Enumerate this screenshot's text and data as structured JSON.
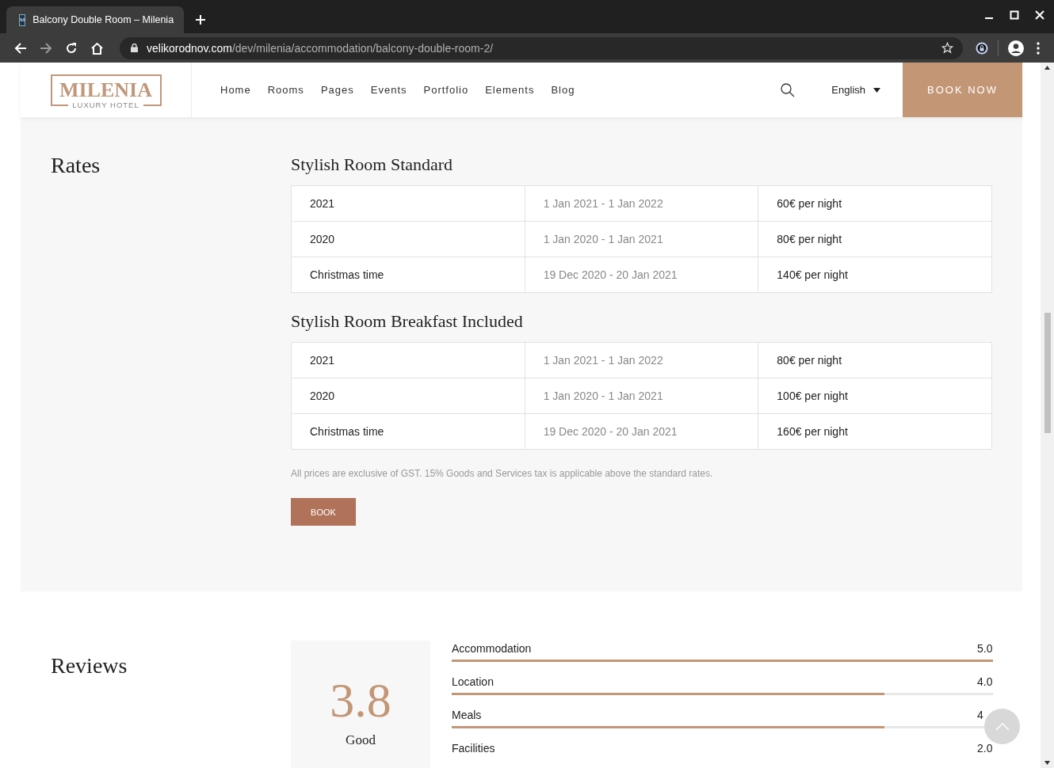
{
  "browser": {
    "tab_title": "Balcony Double Room – Milenia",
    "favicon": "M",
    "url_host": "velikorodnov.com",
    "url_path": "/dev/milenia/accommodation/balcony-double-room-2/"
  },
  "header": {
    "logo": "MILENIA",
    "logo_sub": "LUXURY HOTEL",
    "nav": [
      {
        "label": "Home"
      },
      {
        "label": "Rooms"
      },
      {
        "label": "Pages"
      },
      {
        "label": "Events"
      },
      {
        "label": "Portfolio"
      },
      {
        "label": "Elements"
      },
      {
        "label": "Blog"
      }
    ],
    "language": "English",
    "cta": "BOOK NOW"
  },
  "rates": {
    "title": "Rates",
    "tables": [
      {
        "title": "Stylish Room Standard",
        "rows": [
          {
            "name": "2021",
            "period": "1 Jan 2021 - 1 Jan 2022",
            "price": "60€ per night"
          },
          {
            "name": "2020",
            "period": "1 Jan 2020 - 1 Jan 2021",
            "price": "80€ per night"
          },
          {
            "name": "Christmas time",
            "period": "19 Dec 2020 - 20 Jan 2021",
            "price": "140€ per night"
          }
        ]
      },
      {
        "title": "Stylish Room Breakfast Included",
        "rows": [
          {
            "name": "2021",
            "period": "1 Jan 2021 - 1 Jan 2022",
            "price": "80€ per night"
          },
          {
            "name": "2020",
            "period": "1 Jan 2020 - 1 Jan 2021",
            "price": "100€ per night"
          },
          {
            "name": "Christmas time",
            "period": "19 Dec 2020 - 20 Jan 2021",
            "price": "160€ per night"
          }
        ]
      }
    ],
    "note": "All prices are exclusive of GST. 15% Goods and Services tax is applicable above the standard rates.",
    "book": "BOOK"
  },
  "reviews": {
    "title": "Reviews",
    "score": "3.8",
    "score_label": "Good",
    "categories": [
      {
        "name": "Accommodation",
        "value": "5.0",
        "level": 1
      },
      {
        "name": "Location",
        "value": "4.0",
        "level": 0.8
      },
      {
        "name": "Meals",
        "value": "4",
        "level": 0.8
      },
      {
        "name": "Facilities",
        "value": "2.0"
      }
    ]
  }
}
